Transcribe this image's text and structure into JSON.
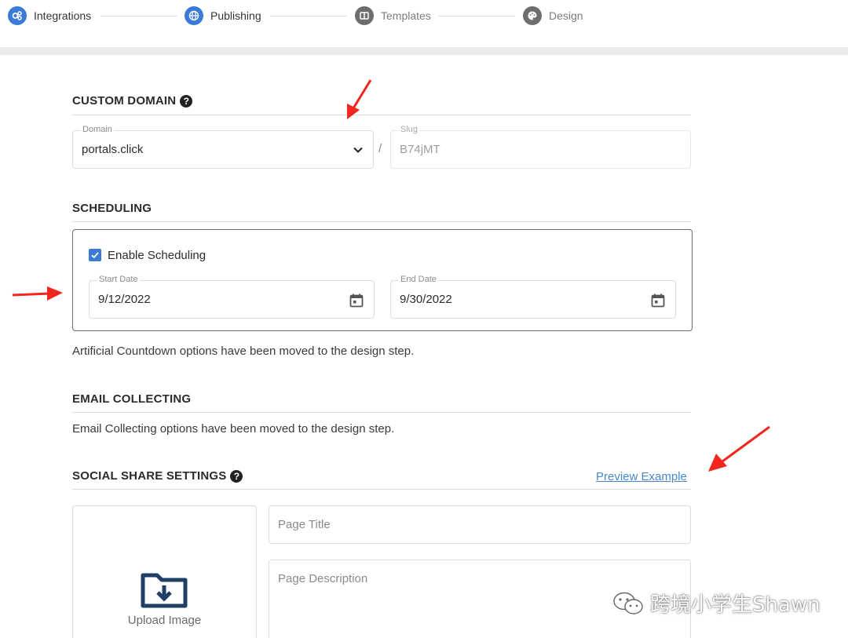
{
  "stepper": {
    "steps": [
      {
        "label": "Integrations",
        "icon": "gears-icon",
        "state": "active"
      },
      {
        "label": "Publishing",
        "icon": "globe-icon",
        "state": "active"
      },
      {
        "label": "Templates",
        "icon": "columns-icon",
        "state": "inactive"
      },
      {
        "label": "Design",
        "icon": "palette-icon",
        "state": "inactive"
      }
    ]
  },
  "custom_domain": {
    "title": "CUSTOM DOMAIN",
    "domain_label": "Domain",
    "domain_value": "portals.click",
    "separator": "/",
    "slug_label": "Slug",
    "slug_value": "B74jMT"
  },
  "scheduling": {
    "title": "SCHEDULING",
    "enable_label": "Enable Scheduling",
    "enabled": true,
    "start_label": "Start Date",
    "start_value": "9/12/2022",
    "end_label": "End Date",
    "end_value": "9/30/2022",
    "note": "Artificial Countdown options have been moved to the design step."
  },
  "email_collecting": {
    "title": "EMAIL COLLECTING",
    "note": "Email Collecting options have been moved to the design step."
  },
  "social_share": {
    "title": "SOCIAL SHARE SETTINGS",
    "preview_link": "Preview Example",
    "upload_label": "Upload Image",
    "page_title_placeholder": "Page Title",
    "page_description_placeholder": "Page Description"
  },
  "watermark": {
    "text": "跨境小学生Shawn"
  },
  "colors": {
    "accent": "#3a7bd5",
    "link": "#4a87c7",
    "arrow": "#f0261f"
  }
}
